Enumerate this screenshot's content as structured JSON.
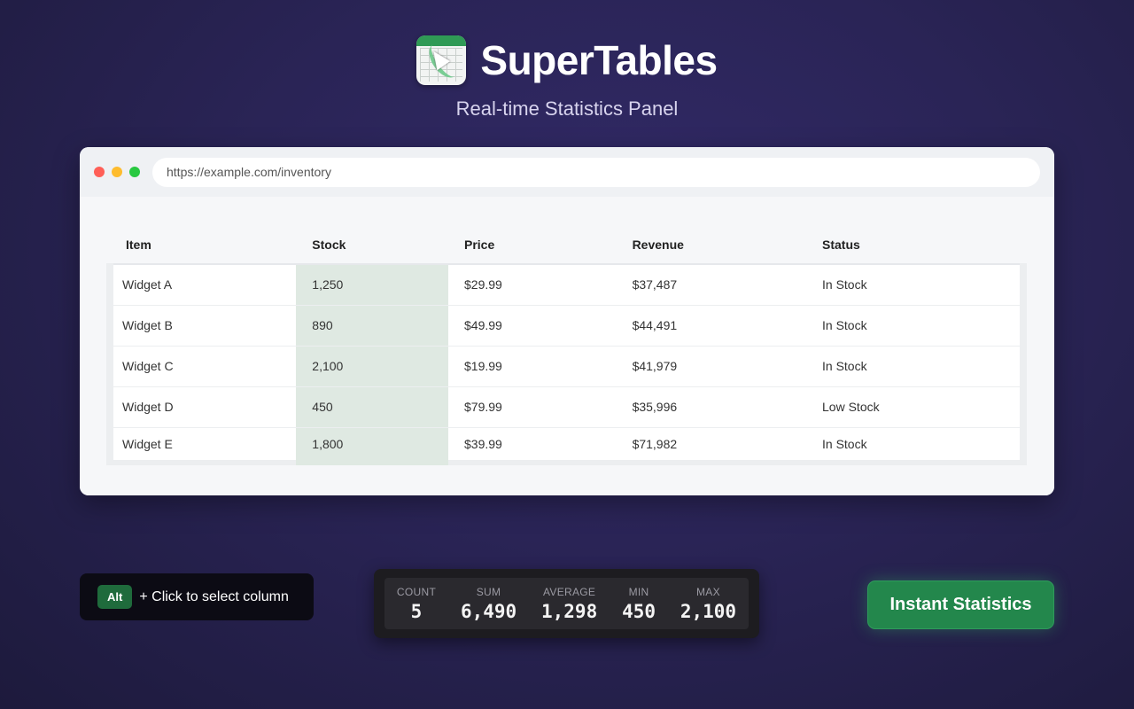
{
  "brand": {
    "name": "SuperTables",
    "tagline": "Real-time Statistics Panel",
    "logo_icon": "spreadsheet-cursor-icon"
  },
  "browser": {
    "url": "https://example.com/inventory"
  },
  "table": {
    "columns": [
      "Item",
      "Stock",
      "Price",
      "Revenue",
      "Status"
    ],
    "selected_column": "Stock",
    "rows": [
      [
        "Widget A",
        "1,250",
        "$29.99",
        "$37,487",
        "In Stock"
      ],
      [
        "Widget B",
        "890",
        "$49.99",
        "$44,491",
        "In Stock"
      ],
      [
        "Widget C",
        "2,100",
        "$19.99",
        "$41,979",
        "In Stock"
      ],
      [
        "Widget D",
        "450",
        "$79.99",
        "$35,996",
        "Low Stock"
      ],
      [
        "Widget E",
        "1,800",
        "$39.99",
        "$71,982",
        "In Stock"
      ]
    ]
  },
  "hint": {
    "key": "Alt",
    "text": "+ Click to select column"
  },
  "stats": [
    {
      "label": "COUNT",
      "value": "5"
    },
    {
      "label": "SUM",
      "value": "6,490"
    },
    {
      "label": "AVERAGE",
      "value": "1,298"
    },
    {
      "label": "MIN",
      "value": "450"
    },
    {
      "label": "MAX",
      "value": "2,100"
    }
  ],
  "cta": {
    "label": "Instant Statistics"
  },
  "colors": {
    "accent": "#23874c",
    "selected_column": "#dfe9e2",
    "background": "#2a2456"
  }
}
